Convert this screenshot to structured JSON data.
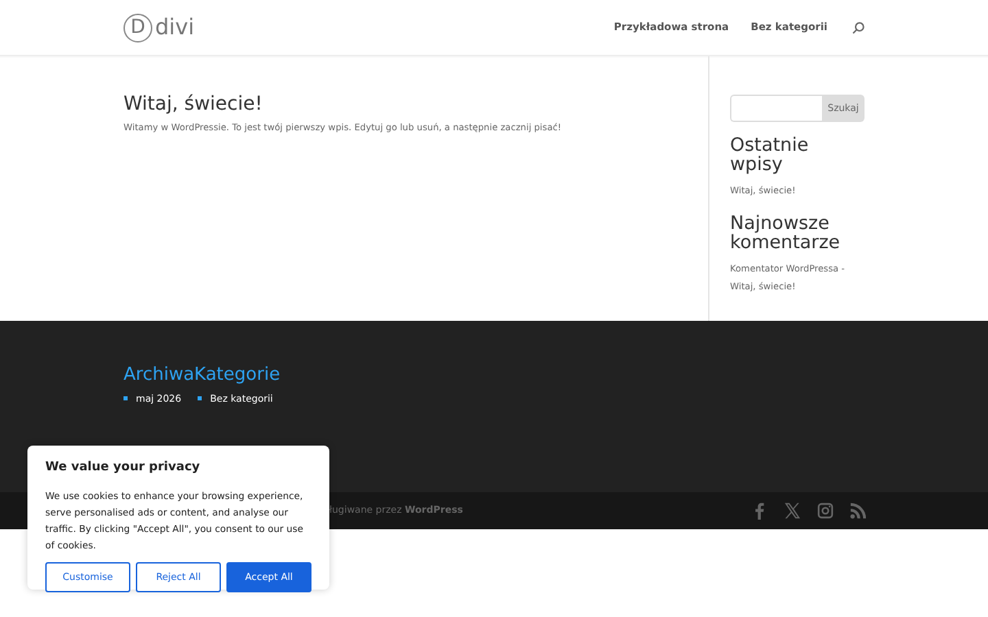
{
  "header": {
    "logo_letter": "D",
    "logo_text": "divi",
    "menu": [
      {
        "label": "Przykładowa strona"
      },
      {
        "label": "Bez kategorii"
      }
    ]
  },
  "post": {
    "title": "Witaj, świecie!",
    "excerpt": "Witamy w WordPressie. To jest twój pierwszy wpis. Edytuj go lub usuń, a następnie zacznij pisać!"
  },
  "sidebar": {
    "search_button": "Szukaj",
    "widgets": [
      {
        "title": "Ostatnie wpisy",
        "links": [
          "Witaj, świecie!"
        ]
      },
      {
        "title": "Najnowsze komentarze",
        "links": [
          "Komentator WordPressa - Witaj, świecie!"
        ]
      }
    ]
  },
  "footer": {
    "widget_title": "ArchiwaKategorie",
    "items": [
      "maj 2026",
      "Bez kategorii"
    ],
    "credits": "ługiwane przez **WordPress**"
  },
  "cookie_banner": {
    "title": "We value your privacy",
    "text": "We use cookies to enhance your browsing experience, serve personalised ads or content, and analyse our traffic. By clicking \"Accept All\", you consent to our use of cookies.",
    "buttons": [
      {
        "label": "Customise",
        "kind": "outline"
      },
      {
        "label": "Reject All",
        "kind": "outline"
      },
      {
        "label": "Accept All",
        "kind": "primary"
      }
    ]
  }
}
